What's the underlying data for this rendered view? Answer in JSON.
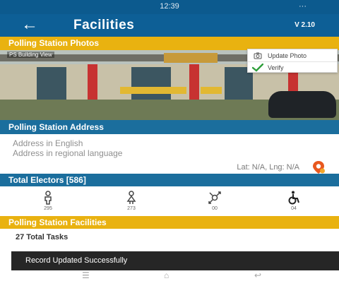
{
  "status_bar": {
    "time": "12:39",
    "indicators": "···"
  },
  "app_bar": {
    "back_icon": "back-arrow-icon",
    "title": "Facilities",
    "version": "V 2.10"
  },
  "photos": {
    "header": "Polling Station Photos",
    "photo_label": "PS Building View",
    "menu": {
      "update_label": "Update Photo",
      "verify_label": "Verify"
    }
  },
  "address": {
    "header": "Polling Station Address",
    "english": "Address in English",
    "regional": "Address in regional language",
    "latlng": "Lat: N/A, Lng: N/A"
  },
  "electors": {
    "header": "Total Electors [586]",
    "items": [
      {
        "icon": "male-icon",
        "count": "295"
      },
      {
        "icon": "female-icon",
        "count": "273"
      },
      {
        "icon": "third-gender-icon",
        "count": "00"
      },
      {
        "icon": "pwd-wheelchair-icon",
        "count": "04"
      }
    ]
  },
  "facilities": {
    "header": "Polling Station Facilities",
    "tasks": "27 Total Tasks"
  },
  "toast": "Record Updated Successfully",
  "colors": {
    "primary": "#0d5f96",
    "accent": "#e9b210",
    "section_blue": "#1b6e9d",
    "toast": "#262626"
  }
}
